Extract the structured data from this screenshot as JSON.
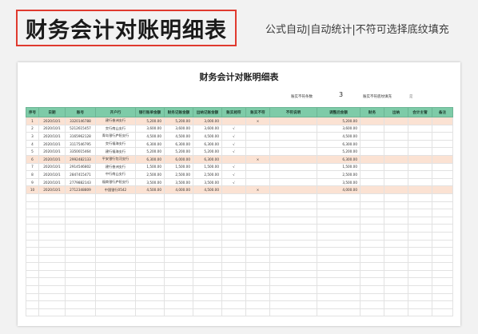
{
  "banner": {
    "title": "财务会计对账明细表",
    "subtitle": "公式自动|自动统计|不符可选择底纹填充"
  },
  "sheet": {
    "title": "财务会计对账明细表",
    "stat_mismatch_label": "账实不符条数",
    "stat_mismatch_value": "3",
    "stat_fill_label": "账实不符底纹填充",
    "stat_fill_value": "是",
    "columns": [
      "序号",
      "日期",
      "账号",
      "开户行",
      "银行账单金额",
      "财务记账金额",
      "出纳记账金额",
      "账实相符",
      "账实不符",
      "不符说明",
      "调整后金额",
      "财务",
      "出纳",
      "会计主管",
      "备注"
    ],
    "rows": [
      {
        "no": "1",
        "date": "2020/10/1",
        "account": "3320146788",
        "bank": "建行香洲支行",
        "bank_amt": "5,200.00",
        "fin_amt": "5,200.00",
        "cash_amt": "3,000.00",
        "match": "",
        "mismatch": "×",
        "note": "",
        "adjusted": "5,200.00",
        "hl": true
      },
      {
        "no": "2",
        "date": "2020/10/1",
        "account": "5212615457",
        "bank": "交行南山支行",
        "bank_amt": "3,600.00",
        "fin_amt": "3,600.00",
        "cash_amt": "3,600.00",
        "match": "√",
        "mismatch": "",
        "note": "",
        "adjusted": "3,600.00",
        "hl": false
      },
      {
        "no": "3",
        "date": "2020/10/1",
        "account": "3165962128",
        "bank": "青岛银行庐阳支行",
        "bank_amt": "4,500.00",
        "fin_amt": "4,500.00",
        "cash_amt": "4,500.00",
        "match": "√",
        "mismatch": "",
        "note": "",
        "adjusted": "4,500.00",
        "hl": false
      },
      {
        "no": "4",
        "date": "2020/10/1",
        "account": "3117546795",
        "bank": "交行福海支行",
        "bank_amt": "6,300.00",
        "fin_amt": "6,300.00",
        "cash_amt": "6,300.00",
        "match": "√",
        "mismatch": "",
        "note": "",
        "adjusted": "6,300.00",
        "hl": false
      },
      {
        "no": "5",
        "date": "2020/10/1",
        "account": "3350015464",
        "bank": "建行福海支行",
        "bank_amt": "5,200.00",
        "fin_amt": "5,200.00",
        "cash_amt": "5,200.00",
        "match": "√",
        "mismatch": "",
        "note": "",
        "adjusted": "5,200.00",
        "hl": false
      },
      {
        "no": "6",
        "date": "2020/10/1",
        "account": "2992482133",
        "bank": "平安银行包河支行",
        "bank_amt": "6,300.00",
        "fin_amt": "6,000.00",
        "cash_amt": "6,300.00",
        "match": "",
        "mismatch": "×",
        "note": "",
        "adjusted": "6,300.00",
        "hl": true
      },
      {
        "no": "7",
        "date": "2020/10/1",
        "account": "2914546802",
        "bank": "建行香洲支行",
        "bank_amt": "1,500.00",
        "fin_amt": "1,500.00",
        "cash_amt": "1,500.00",
        "match": "√",
        "mismatch": "",
        "note": "",
        "adjusted": "1,500.00",
        "hl": false
      },
      {
        "no": "8",
        "date": "2020/10/1",
        "account": "2847415471",
        "bank": "中行南山支行",
        "bank_amt": "2,500.00",
        "fin_amt": "2,500.00",
        "cash_amt": "2,500.00",
        "match": "√",
        "mismatch": "",
        "note": "",
        "adjusted": "2,500.00",
        "hl": false
      },
      {
        "no": "9",
        "date": "2020/10/1",
        "account": "2779882143",
        "bank": "福商银行庐阳支行",
        "bank_amt": "3,500.00",
        "fin_amt": "3,500.00",
        "cash_amt": "3,500.00",
        "match": "√",
        "mismatch": "",
        "note": "",
        "adjusted": "3,500.00",
        "hl": false
      },
      {
        "no": "10",
        "date": "2020/10/1",
        "account": "2712348809",
        "bank": "中国银行0542",
        "bank_amt": "4,500.00",
        "fin_amt": "4,000.00",
        "cash_amt": "4,500.00",
        "match": "",
        "mismatch": "×",
        "note": "",
        "adjusted": "4,000.00",
        "hl": true
      }
    ]
  },
  "colors": {
    "header_green": "#7ecba8",
    "highlight_row": "#fbe2d3",
    "title_border": "#e03a2f"
  }
}
